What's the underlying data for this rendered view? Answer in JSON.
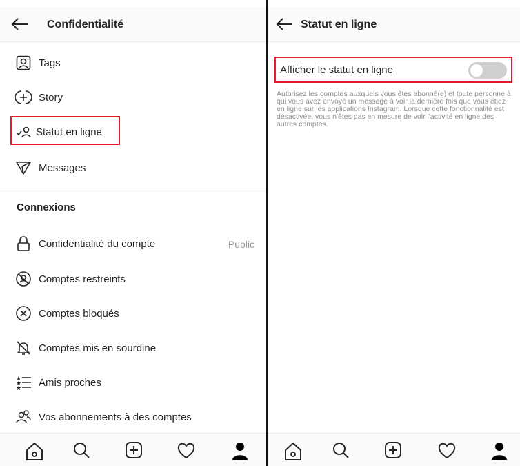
{
  "left": {
    "header": {
      "title": "Confidentialité"
    },
    "items": [
      {
        "icon": "tag-icon",
        "label": "Tags"
      },
      {
        "icon": "story-icon",
        "label": "Story"
      },
      {
        "icon": "online-status-icon",
        "label": "Statut en ligne"
      },
      {
        "icon": "messages-icon",
        "label": "Messages"
      }
    ],
    "connections": {
      "title": "Connexions",
      "items": [
        {
          "icon": "lock-icon",
          "label": "Confidentialité du compte",
          "value": "Public"
        },
        {
          "icon": "restricted-icon",
          "label": "Comptes restreints"
        },
        {
          "icon": "blocked-icon",
          "label": "Comptes bloqués"
        },
        {
          "icon": "muted-icon",
          "label": "Comptes mis en sourdine"
        },
        {
          "icon": "close-friends-icon",
          "label": "Amis proches"
        },
        {
          "icon": "following-icon",
          "label": "Vos abonnements à des comptes"
        }
      ]
    }
  },
  "right": {
    "header": {
      "title": "Statut en ligne"
    },
    "setting": {
      "label": "Afficher le statut en ligne",
      "toggle_on": false,
      "description": "Autorisez les comptes auxquels vous êtes abonné(e) et toute personne à qui vous avez envoyé un message à voir la dernière fois que vous étiez en ligne sur les applications Instagram. Lorsque cette fonctionnalité est désactivée, vous n'êtes pas en mesure de voir l'activité en ligne des autres comptes."
    }
  },
  "nav_icons": [
    "home-icon",
    "search-icon",
    "new-post-icon",
    "activity-icon",
    "profile-icon"
  ],
  "colors": {
    "highlight": "#e0192b",
    "toggle_off": "#cfcfcf",
    "secondary_text": "#8e8e8e"
  }
}
